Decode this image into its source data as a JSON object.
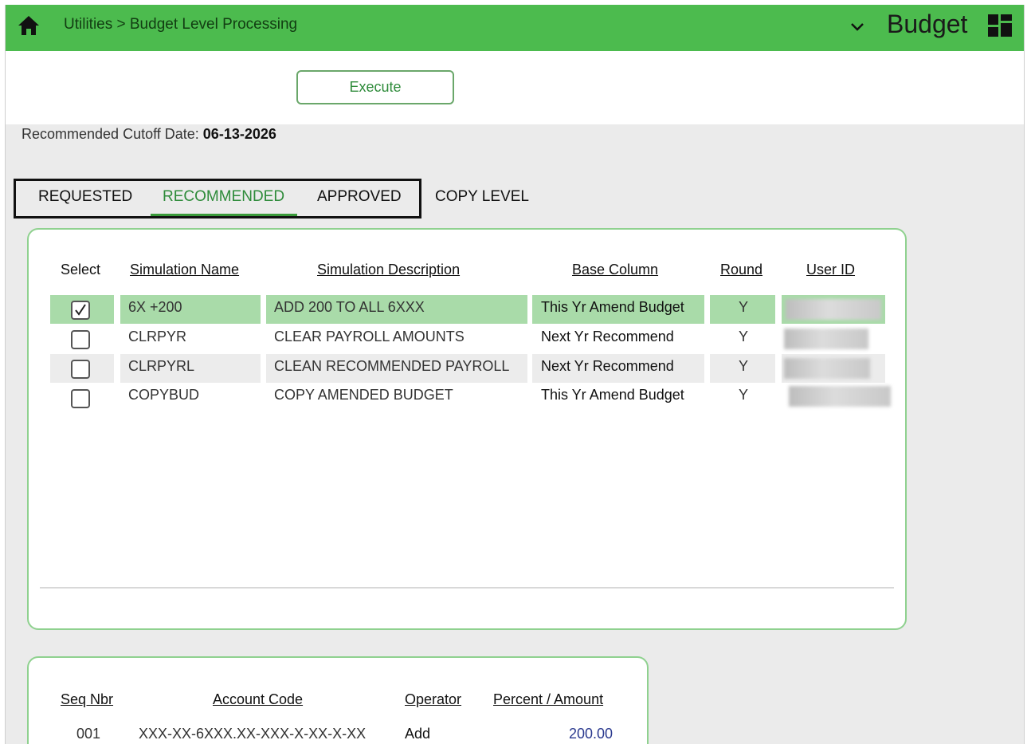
{
  "header": {
    "breadcrumb": "Utilities > Budget Level Processing",
    "app_title": "Budget",
    "bar_color": "#4cbb4e"
  },
  "toolbar": {
    "execute_label": "Execute"
  },
  "cutoff": {
    "label": "Recommended Cutoff Date: ",
    "value": "06-13-2026"
  },
  "tabs": [
    {
      "label": "REQUESTED",
      "active": false
    },
    {
      "label": "RECOMMENDED",
      "active": true
    },
    {
      "label": "APPROVED",
      "active": false
    },
    {
      "label": "COPY LEVEL",
      "active": false
    }
  ],
  "simulations": {
    "columns": [
      "Select",
      "Simulation Name",
      "Simulation Description",
      "Base Column",
      "Round",
      "User ID"
    ],
    "rows": [
      {
        "checked": true,
        "name": "6X +200",
        "description": "ADD 200 TO ALL 6XXX",
        "base": "This Yr Amend Budget",
        "round": "Y",
        "user_id": ""
      },
      {
        "checked": false,
        "name": "CLRPYR",
        "description": "CLEAR PAYROLL AMOUNTS",
        "base": "Next Yr Recommend",
        "round": "Y",
        "user_id": ""
      },
      {
        "checked": false,
        "name": "CLRPYRL",
        "description": "CLEAN RECOMMENDED PAYROLL",
        "base": "Next Yr Recommend",
        "round": "Y",
        "user_id": ""
      },
      {
        "checked": false,
        "name": "COPYBUD",
        "description": "COPY AMENDED BUDGET",
        "base": "This Yr Amend Budget",
        "round": "Y",
        "user_id": ""
      }
    ]
  },
  "accounts": {
    "columns": [
      "Seq Nbr",
      "Account Code",
      "Operator",
      "Percent / Amount"
    ],
    "rows": [
      {
        "seq": "001",
        "code": "XXX-XX-6XXX.XX-XXX-X-XX-X-XX",
        "operator": "Add",
        "amount": "200.00"
      }
    ]
  }
}
